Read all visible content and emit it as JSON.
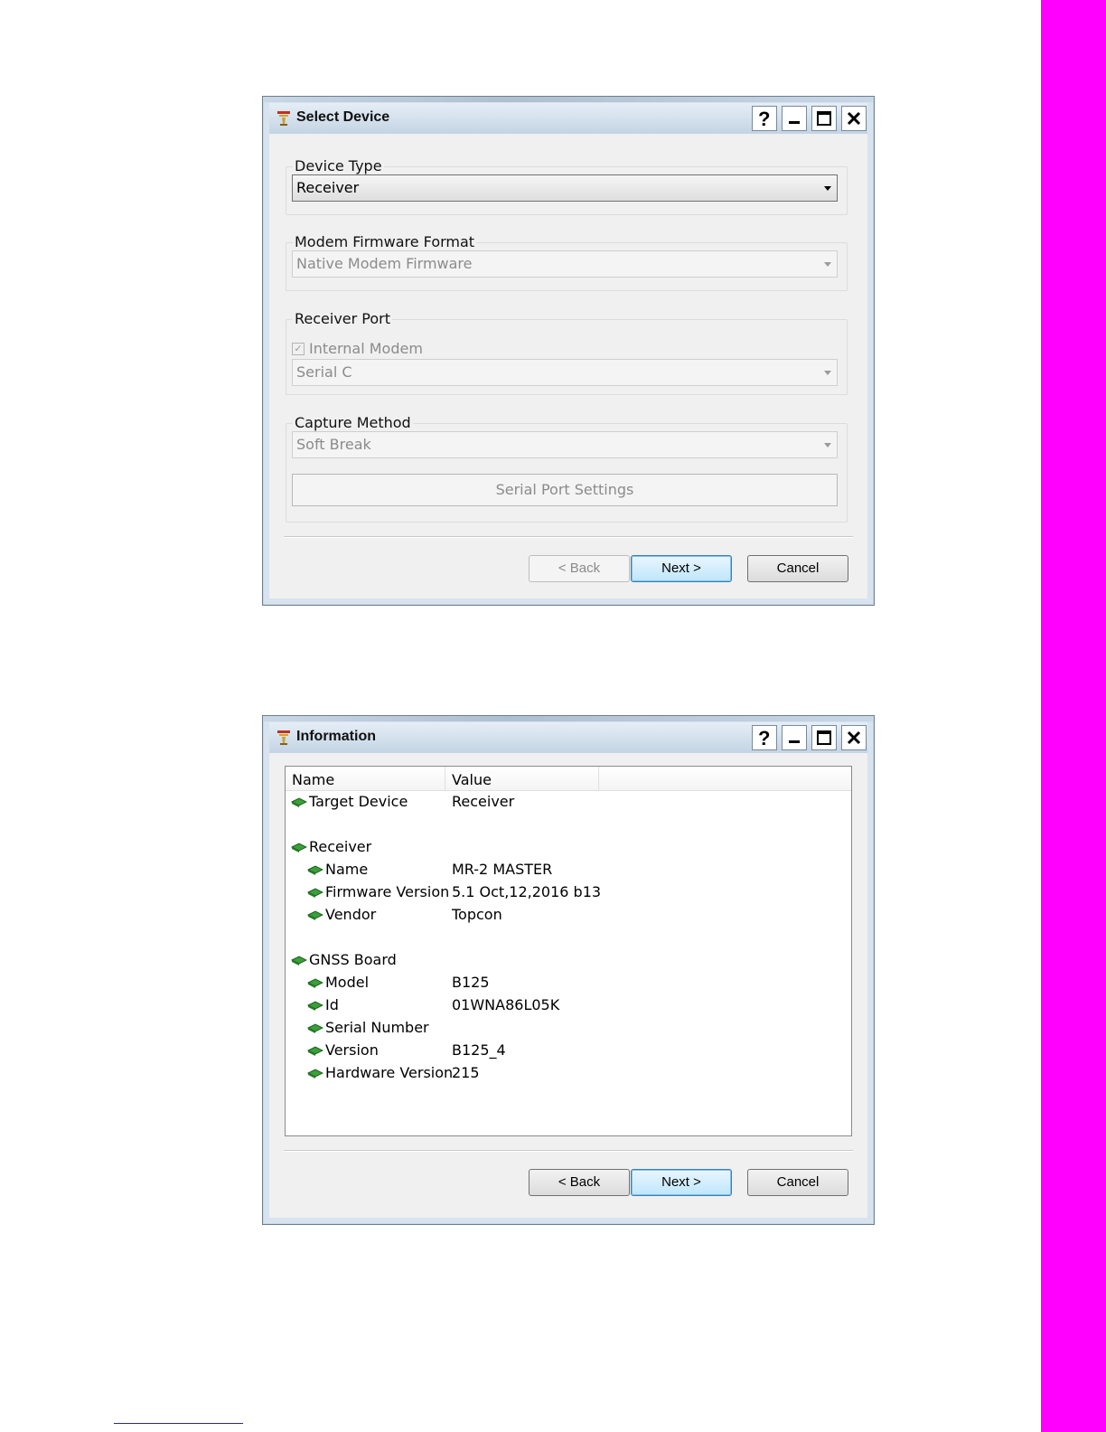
{
  "select_device": {
    "title": "Select Device",
    "device_type": {
      "label": "Device Type",
      "value": "Receiver"
    },
    "modem_firmware_format": {
      "label": "Modem Firmware Format",
      "value": "Native Modem Firmware"
    },
    "receiver_port": {
      "label": "Receiver Port",
      "internal_modem_label": "Internal Modem",
      "internal_modem_checked": true,
      "value": "Serial C"
    },
    "capture_method": {
      "label": "Capture Method",
      "value": "Soft Break",
      "serial_port_settings": "Serial Port Settings"
    },
    "buttons": {
      "back": "< Back",
      "next": "Next >",
      "cancel": "Cancel"
    }
  },
  "information": {
    "title": "Information",
    "columns": [
      "Name",
      "Value"
    ],
    "rows": [
      {
        "name": "Target Device",
        "value": "Receiver",
        "level": 0
      },
      {
        "name": "Receiver",
        "value": "",
        "level": 0
      },
      {
        "name": "Name",
        "value": "MR-2  MASTER",
        "level": 1
      },
      {
        "name": "Firmware Version",
        "value": "5.1 Oct,12,2016 b13",
        "level": 1
      },
      {
        "name": "Vendor",
        "value": "Topcon",
        "level": 1
      },
      {
        "name": "GNSS Board",
        "value": "",
        "level": 0
      },
      {
        "name": "Model",
        "value": "B125",
        "level": 1
      },
      {
        "name": "Id",
        "value": "01WNA86L05K",
        "level": 1
      },
      {
        "name": "Serial Number",
        "value": "",
        "level": 1
      },
      {
        "name": "Version",
        "value": "B125_4",
        "level": 1
      },
      {
        "name": "Hardware Version",
        "value": "215",
        "level": 1
      }
    ],
    "buttons": {
      "back": "< Back",
      "next": "Next >",
      "cancel": "Cancel"
    }
  },
  "colors": {
    "page_side_bar": "#ff00ff",
    "title_bar": "#c4d4e4",
    "default_button_border": "#3c7fb1"
  },
  "icons": {
    "app": "app-logo-icon",
    "tree_item": "green-gem-icon"
  }
}
